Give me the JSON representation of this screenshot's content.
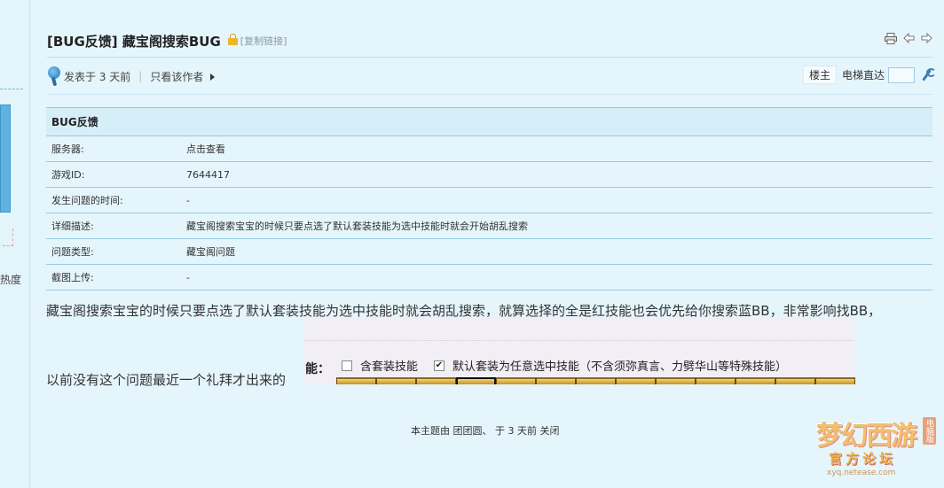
{
  "sidebar": {
    "edge_text": "热度"
  },
  "post": {
    "title": "[BUG反馈] 藏宝阁搜索BUG",
    "copy_link": "[复制链接]",
    "meta": {
      "posted": "发表于 3 天前",
      "only_author": "只看该作者"
    },
    "floor": {
      "owner_label": "楼主",
      "goto_label": "电梯直达",
      "goto_value": ""
    }
  },
  "bug_table": {
    "title": "BUG反馈",
    "rows": [
      {
        "key": "服务器:",
        "value": "点击查看"
      },
      {
        "key": "游戏ID:",
        "value": "7644417"
      },
      {
        "key": "发生问题的时间:",
        "value": "-"
      },
      {
        "key": "详细描述:",
        "value": "藏宝阁搜索宝宝的时候只要点选了默认套装技能为选中技能时就会开始胡乱搜索"
      },
      {
        "key": "问题类型:",
        "value": "藏宝阁问题"
      },
      {
        "key": "截图上传:",
        "value": "-"
      }
    ]
  },
  "body": {
    "line1": "藏宝阁搜索宝宝的时候只要点选了默认套装技能为选中技能时就会胡乱搜索，就算选择的全是红技能也会优先给你搜索蓝BB，非常影响找BB，",
    "line2": "以前没有这个问题最近一个礼拜才出来的"
  },
  "embed": {
    "label": "能：",
    "option1": "含套装技能",
    "option1_checked": false,
    "option2": "默认套装为任意选中技能（不含须弥真言、力劈华山等特殊技能）",
    "option2_checked": true,
    "checkmark": "✔"
  },
  "footer": {
    "closed_note": "本主题由 团团圆、 于 3 天前 关闭"
  },
  "watermark": {
    "main": "梦幻西游",
    "tag": "电脑版",
    "sub": "官方论坛",
    "url": "xyq.netease.com"
  },
  "icons": {
    "print": "print-icon",
    "prev": "arrow-left-icon",
    "next": "arrow-right-icon",
    "wrench": "wrench-icon"
  }
}
